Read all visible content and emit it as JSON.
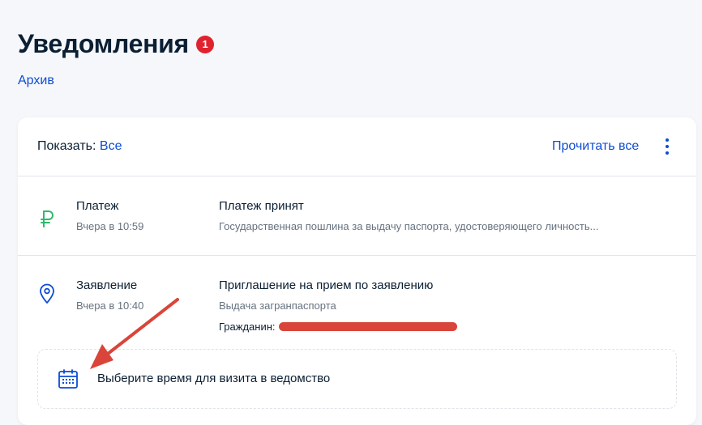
{
  "header": {
    "title": "Уведомления",
    "badge_count": "1",
    "archive_link": "Архив"
  },
  "toolbar": {
    "filter_label": "Показать:",
    "filter_value": "Все",
    "read_all": "Прочитать все",
    "more_icon": "kebab-menu-icon"
  },
  "notifications": [
    {
      "icon": "ruble-icon",
      "category": "Платеж",
      "time": "Вчера в 10:59",
      "title": "Платеж принят",
      "description": "Государственная пошлина за выдачу паспорта, удостоверяющего личность..."
    },
    {
      "icon": "location-pin-icon",
      "category": "Заявление",
      "time": "Вчера в 10:40",
      "title": "Приглашение на прием по заявлению",
      "description": "Выдача загранпаспорта",
      "citizen_label": "Гражданин:",
      "action": {
        "icon": "calendar-icon",
        "label": "Выберите время для визита в ведомство"
      }
    }
  ],
  "colors": {
    "accent": "#0d4cd3",
    "badge": "#e0222f",
    "ruble_icon": "#2fb96d",
    "annotation_arrow": "#d9453a"
  }
}
